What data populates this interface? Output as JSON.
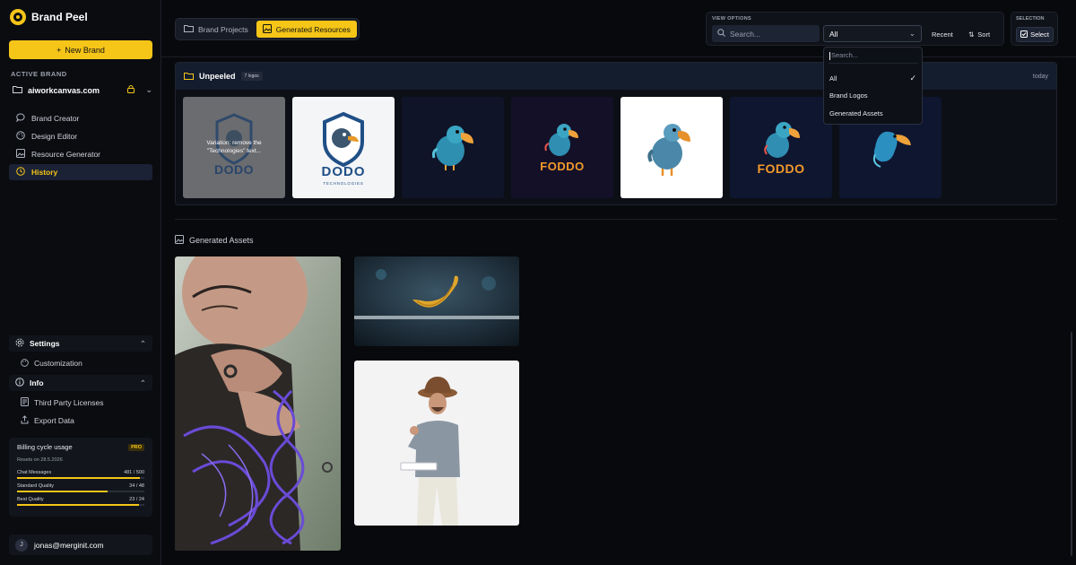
{
  "app": {
    "name": "Brand Peel"
  },
  "sidebar": {
    "new_brand_label": "New Brand",
    "active_brand_label": "ACTIVE BRAND",
    "brand_name": "aiworkcanvas.com",
    "nav": [
      {
        "label": "Brand Creator",
        "icon": "chat-bubble-icon"
      },
      {
        "label": "Design Editor",
        "icon": "palette-icon"
      },
      {
        "label": "Resource Generator",
        "icon": "image-icon"
      },
      {
        "label": "History",
        "icon": "clock-icon",
        "active": true
      }
    ],
    "settings": {
      "label": "Settings",
      "items": [
        "Customization"
      ]
    },
    "info": {
      "label": "Info",
      "items": [
        "Third Party Licenses",
        "Export Data"
      ]
    },
    "billing": {
      "title": "Billing cycle usage",
      "badge": "PRO",
      "resets": "Resets on 28.5.2026",
      "meters": [
        {
          "label": "Chat Messages",
          "value": "481 / 500",
          "fraction": 0.962
        },
        {
          "label": "Standard Quality",
          "value": "34 / 48",
          "fraction": 0.708
        },
        {
          "label": "Best Quality",
          "value": "23 / 24",
          "fraction": 0.958
        }
      ]
    },
    "user": {
      "email": "jonas@merginit.com",
      "initial": "J"
    }
  },
  "tabs": [
    {
      "label": "Brand Projects",
      "active": false
    },
    {
      "label": "Generated Resources",
      "active": true
    }
  ],
  "view_options": {
    "label": "VIEW OPTIONS",
    "search_placeholder": "Search...",
    "filter_value": "All",
    "recent_label": "Recent",
    "sort_label": "Sort"
  },
  "selection": {
    "label": "SELECTION",
    "button": "Select"
  },
  "dropdown": {
    "search_placeholder": "Search...",
    "options": [
      {
        "label": "All",
        "selected": true
      },
      {
        "label": "Brand Logos",
        "selected": false
      },
      {
        "label": "Generated Assets",
        "selected": false
      }
    ]
  },
  "unpeeled": {
    "title": "Unpeeled",
    "count": "7 logos",
    "date": "today",
    "overlay_text": "Variation: remove the \"Technologies\" text...",
    "logo_texts": {
      "t1": "DODO",
      "t2_main": "DODO",
      "t2_sub": "TECHNOLOGIES",
      "t4": "FODDO",
      "t6": "FODDO"
    }
  },
  "generated_assets": {
    "title": "Generated Assets"
  },
  "colors": {
    "accent": "#f5c518",
    "sidebar_bg": "#0b0c10",
    "page_bg": "#08090c",
    "header_bg": "#141d2e"
  }
}
